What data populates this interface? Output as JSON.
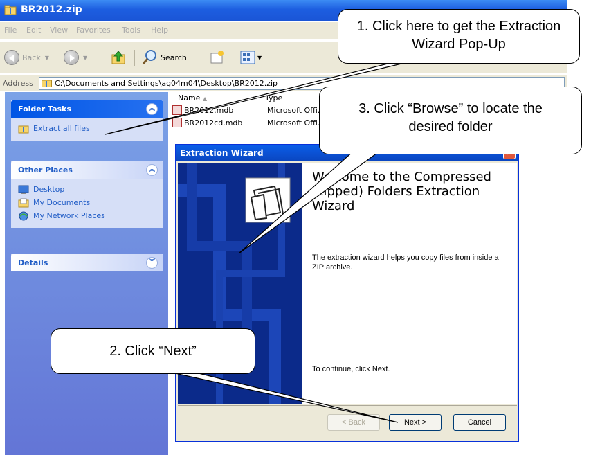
{
  "window": {
    "title": "BR2012.zip"
  },
  "menu": [
    "File",
    "Edit",
    "View",
    "Favorites",
    "Tools",
    "Help"
  ],
  "toolbar": {
    "back": "Back",
    "search": "Search"
  },
  "address": {
    "label": "Address",
    "path": "C:\\Documents and Settings\\ag04m04\\Desktop\\BR2012.zip"
  },
  "sidebar": {
    "folder_tasks": {
      "title": "Folder Tasks",
      "items": [
        "Extract all files"
      ]
    },
    "other_places": {
      "title": "Other Places",
      "items": [
        "Desktop",
        "My Documents",
        "My Network Places"
      ]
    },
    "details": {
      "title": "Details"
    }
  },
  "filelist": {
    "columns": [
      "Name",
      "Type"
    ],
    "rows": [
      {
        "name": "BR2012.mdb",
        "type": "Microsoft Offi..."
      },
      {
        "name": "BR2012cd.mdb",
        "type": "Microsoft Offi..."
      }
    ]
  },
  "wizard": {
    "title": "Extraction Wizard",
    "heading": "Welcome to the Compressed (zipped) Folders Extraction Wizard",
    "description": "The extraction wizard helps you copy files from inside a ZIP archive.",
    "continue_text": "To continue, click Next.",
    "buttons": {
      "back": "< Back",
      "next": "Next >",
      "cancel": "Cancel"
    }
  },
  "callouts": {
    "step1": "1. Click here to get the Extraction Wizard Pop-Up",
    "step2": "2. Click “Next”",
    "step3": "3. Click “Browse” to locate the desired folder"
  },
  "colors": {
    "xp_blue": "#0a5fe8",
    "sidebar_blue": "#6375d6",
    "link_blue": "#215dc6"
  }
}
